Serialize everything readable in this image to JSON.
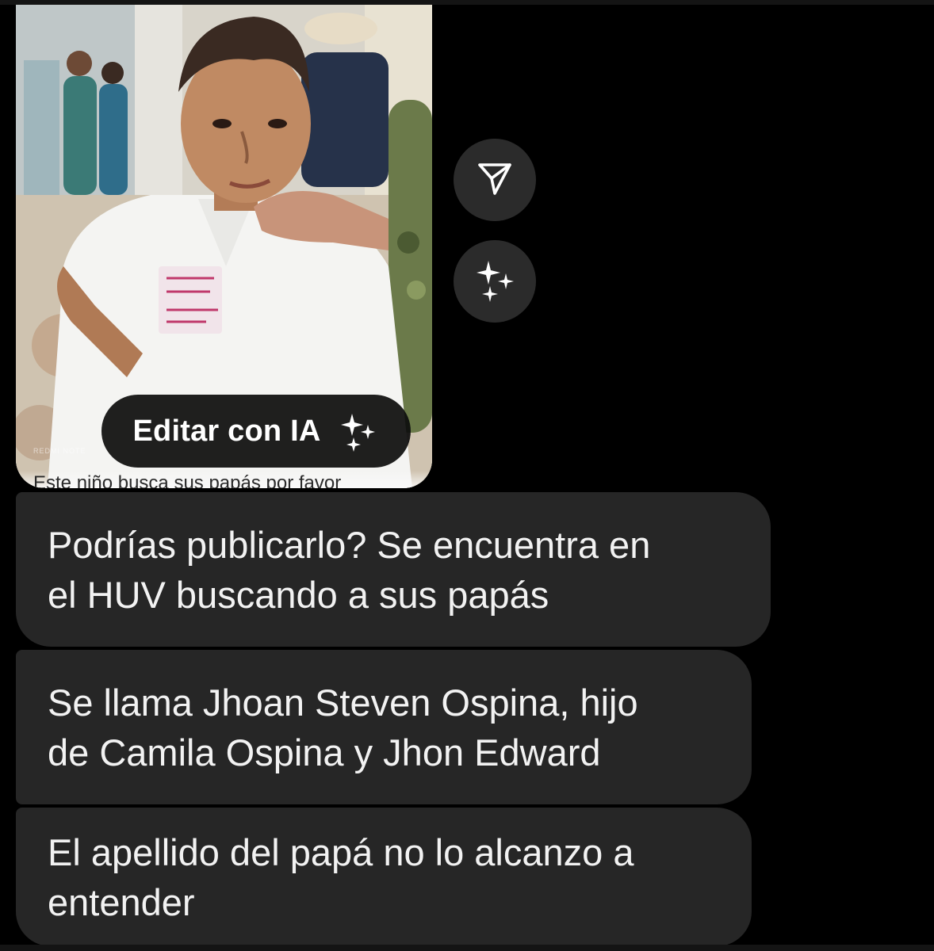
{
  "photo": {
    "edit_button_label": "Editar con IA",
    "caption": "Este niño busca sus papás por favor",
    "watermark": "REDMI NOTE"
  },
  "actions": {
    "share_icon": "send-icon",
    "ai_icon": "sparkles-icon"
  },
  "messages": [
    {
      "text": "Podrías publicarlo? Se encuentra en\nel HUV buscando a sus papás"
    },
    {
      "text": "Se llama Jhoan Steven Ospina, hijo\nde Camila Ospina y Jhon Edward"
    },
    {
      "text": "El apellido del papá no lo alcanzo a\nentender"
    }
  ],
  "colors": {
    "background": "#000000",
    "bubble": "#262626",
    "action_button": "#2b2b2b",
    "text": "#f2f2f2"
  }
}
